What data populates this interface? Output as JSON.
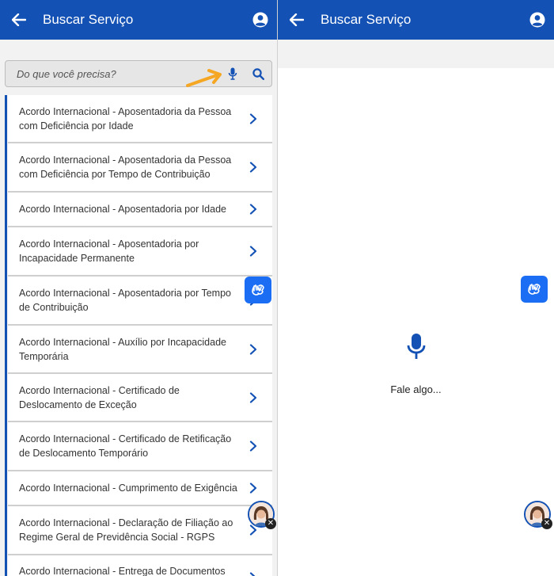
{
  "left": {
    "appbar": {
      "title": "Buscar Serviço"
    },
    "search": {
      "placeholder": "Do que você precisa?"
    },
    "items": [
      {
        "label": "Acordo Internacional - Aposentadoria da Pessoa com Deficiência por Idade"
      },
      {
        "label": "Acordo Internacional - Aposentadoria da Pessoa com Deficiência por Tempo de Contribuição"
      },
      {
        "label": "Acordo Internacional - Aposentadoria por Idade"
      },
      {
        "label": "Acordo Internacional - Aposentadoria por Incapacidade Permanente"
      },
      {
        "label": "Acordo Internacional - Aposentadoria por Tempo de Contribuição"
      },
      {
        "label": "Acordo Internacional - Auxílio por Incapacidade Temporária"
      },
      {
        "label": "Acordo Internacional - Certificado de Deslocamento de Exceção"
      },
      {
        "label": "Acordo Internacional - Certificado de Retificação de Deslocamento Temporário"
      },
      {
        "label": "Acordo Internacional - Cumprimento de Exigência"
      },
      {
        "label": "Acordo Internacional - Declaração de Filiação ao Regime Geral de Previdência Social - RGPS"
      },
      {
        "label": "Acordo Internacional - Entrega de Documentos"
      }
    ]
  },
  "right": {
    "appbar": {
      "title": "Buscar Serviço"
    },
    "voice": {
      "prompt": "Fale algo..."
    }
  },
  "colors": {
    "brand": "#1351b4",
    "libras": "#1b6ef3",
    "annotation_arrow": "#f5a623"
  }
}
